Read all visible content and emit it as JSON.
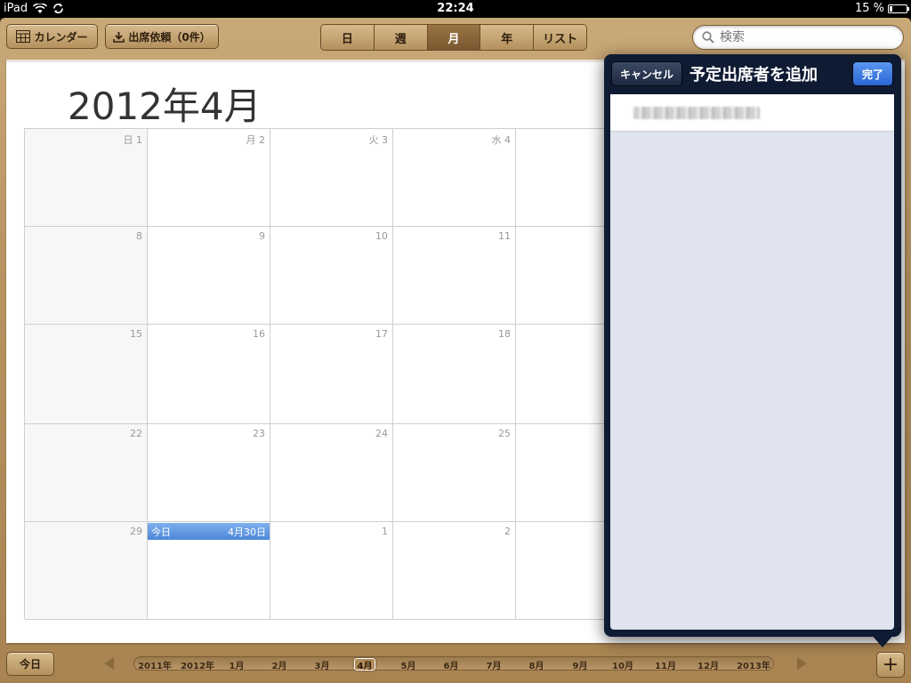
{
  "status_bar": {
    "device": "iPad",
    "time": "22:24",
    "battery_text": "15 %",
    "battery_level": 0.15
  },
  "toolbar": {
    "calendars_label": "カレンダー",
    "invitations_label": "出席依頼（0件）",
    "view_tabs": [
      {
        "label": "日",
        "active": false
      },
      {
        "label": "週",
        "active": false
      },
      {
        "label": "月",
        "active": true
      },
      {
        "label": "年",
        "active": false
      },
      {
        "label": "リスト",
        "active": false
      }
    ],
    "search_placeholder": "検索"
  },
  "calendar": {
    "month_title": "2012年4月",
    "weekday_headers": [
      "日 1",
      "月 2",
      "火 3",
      "水 4"
    ],
    "rows": [
      [
        "日 1",
        "月 2",
        "火 3",
        "水 4",
        ""
      ],
      [
        "8",
        "9",
        "10",
        "11",
        ""
      ],
      [
        "15",
        "16",
        "17",
        "18",
        ""
      ],
      [
        "22",
        "23",
        "24",
        "25",
        ""
      ],
      [
        "29",
        "",
        "1",
        "2",
        ""
      ]
    ],
    "today_label": "今日",
    "today_date": "4月30日"
  },
  "popover": {
    "cancel_label": "キャンセル",
    "title": "予定出席者を追加",
    "done_label": "完了"
  },
  "bottom_bar": {
    "today_button": "今日",
    "timeline": [
      "2011年",
      "2012年",
      "1月",
      "2月",
      "3月",
      "4月",
      "5月",
      "6月",
      "7月",
      "8月",
      "9月",
      "10月",
      "11月",
      "12月",
      "2013年"
    ],
    "current_index": 5,
    "add_label": "+"
  },
  "colors": {
    "accent_blue": "#2966d4",
    "popover_bg": "#0f1b33",
    "leather": "#b8925f"
  }
}
